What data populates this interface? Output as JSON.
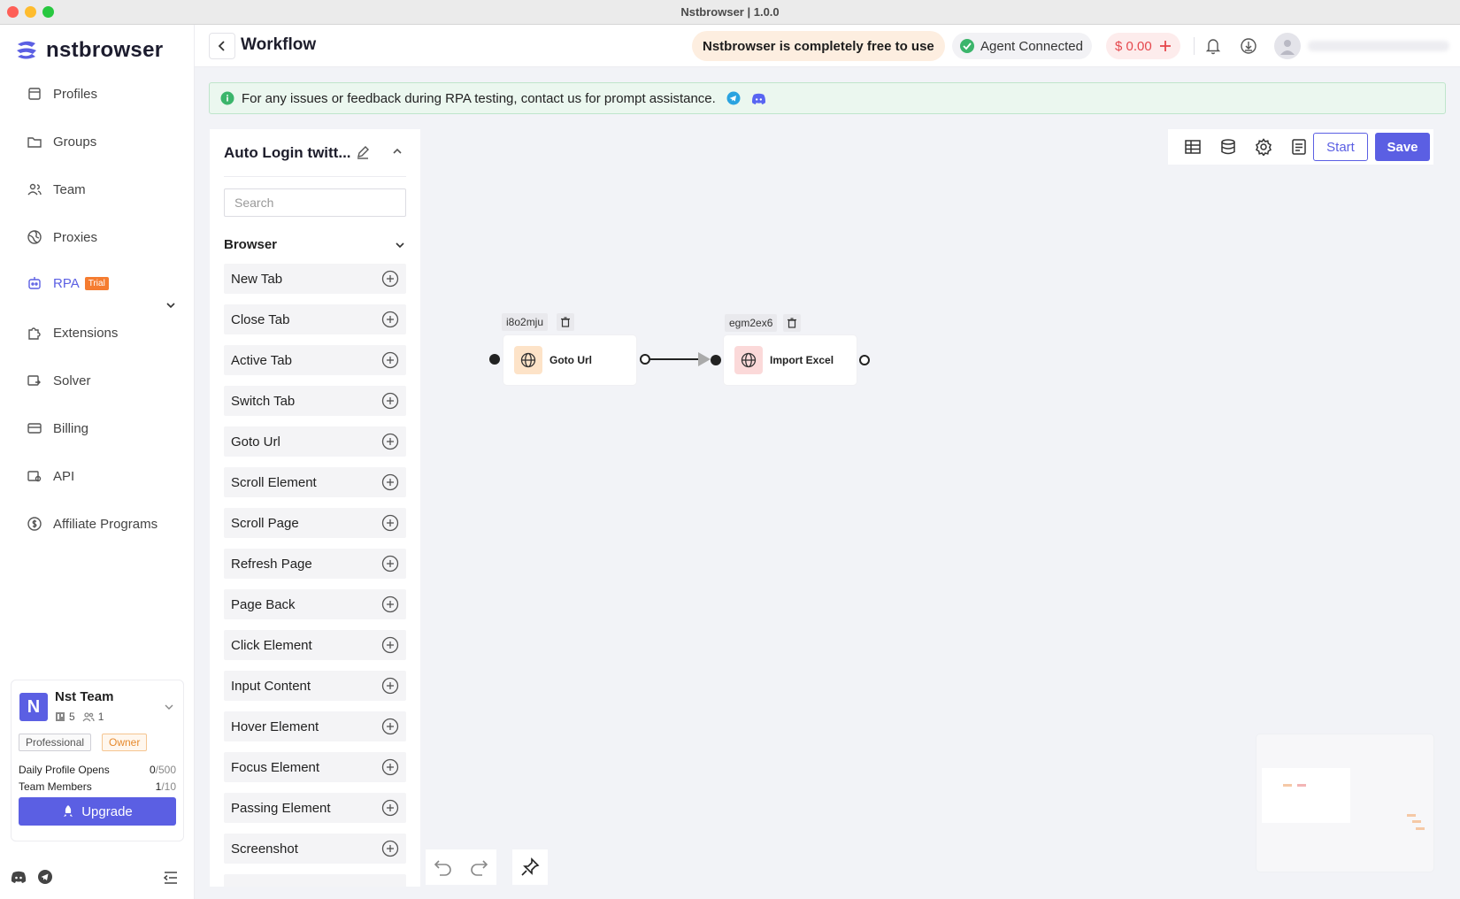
{
  "window": {
    "title": "Nstbrowser | 1.0.0"
  },
  "brand": {
    "name": "nstbrowser",
    "accent": "#5b5fe3"
  },
  "sidebar": {
    "items": [
      {
        "label": "Profiles",
        "icon": "profiles-icon"
      },
      {
        "label": "Groups",
        "icon": "folder-icon"
      },
      {
        "label": "Team",
        "icon": "team-icon"
      },
      {
        "label": "Proxies",
        "icon": "globe-icon"
      },
      {
        "label": "RPA",
        "icon": "robot-icon",
        "badge": "Trial"
      },
      {
        "label": "Extensions",
        "icon": "puzzle-icon"
      },
      {
        "label": "Solver",
        "icon": "solver-icon"
      },
      {
        "label": "Billing",
        "icon": "card-icon"
      },
      {
        "label": "API",
        "icon": "api-icon"
      },
      {
        "label": "Affiliate Programs",
        "icon": "dollar-icon"
      }
    ],
    "team": {
      "initial": "N",
      "name": "Nst Team",
      "profiles_count": "5",
      "members_count": "1",
      "plan": "Professional",
      "role": "Owner",
      "daily_label": "Daily Profile Opens",
      "daily_used": "0",
      "daily_limit": "/500",
      "members_label": "Team Members",
      "members_used": "1",
      "members_limit": "/10",
      "upgrade_label": "Upgrade"
    }
  },
  "header": {
    "title": "Workflow",
    "free_banner": "Nstbrowser is completely free to use",
    "agent_status": "Agent Connected",
    "balance": "$ 0.00"
  },
  "info_banner": {
    "text": "For any issues or feedback during RPA testing, contact us for prompt assistance."
  },
  "panel": {
    "workflow_name": "Auto Login twitt...",
    "search_placeholder": "Search",
    "category": "Browser",
    "nodes": [
      "New Tab",
      "Close Tab",
      "Active Tab",
      "Switch Tab",
      "Goto Url",
      "Scroll Element",
      "Scroll Page",
      "Refresh Page",
      "Page Back",
      "Click Element",
      "Input Content",
      "Hover Element",
      "Focus Element",
      "Passing Element",
      "Screenshot"
    ]
  },
  "toolbar": {
    "start_label": "Start",
    "save_label": "Save"
  },
  "canvas": {
    "nodes": [
      {
        "id": "i8o2mju",
        "label": "Goto Url",
        "icon": "globe-icon",
        "icon_bg": "#fde3c8"
      },
      {
        "id": "egm2ex6",
        "label": "Import Excel",
        "icon": "globe-icon",
        "icon_bg": "#fbd9d9"
      }
    ]
  }
}
